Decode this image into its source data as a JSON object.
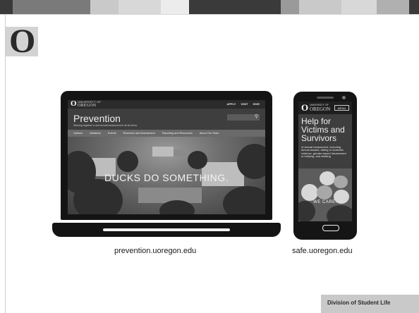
{
  "slide": {
    "logo": "O",
    "footer": "Division of Student Life",
    "colors": {
      "stripe": [
        "#3a3a3a",
        "#7a7a7a",
        "#c9c9c9",
        "#3a3a3a",
        "#9a9a9a",
        "#c9c9c9",
        "#7a7a7a",
        "#3a3a3a",
        "#c9c9c9",
        "#6a6a6a"
      ]
    }
  },
  "laptop": {
    "site_logo_mark": "O",
    "site_brand_small": "UNIVERSITY OF",
    "site_brand_big": "OREGON",
    "top_links": [
      "APPLY",
      "VISIT",
      "GIVE"
    ],
    "title": "Prevention",
    "tagline": "Working together to end sexual harassment in all its forms.",
    "nav": [
      "Options",
      "Initiatives",
      "Events",
      "Research and Assessment",
      "Reporting and Resources",
      "About Our Team"
    ],
    "hero_text": "DUCKS DO SOMETHING.",
    "caption": "prevention.uoregon.edu"
  },
  "phone": {
    "site_logo_mark": "O",
    "site_brand_small": "UNIVERSITY OF",
    "site_brand_big": "OREGON",
    "menu": "MENU",
    "title": "Help for Victims and Survivors",
    "description": "of sexual harassment, including sexual assault, dating or domestic violence, gender-based harassment or bullying, and stalking",
    "hero_text": "WE CARE.",
    "caption": "safe.uoregon.edu"
  }
}
